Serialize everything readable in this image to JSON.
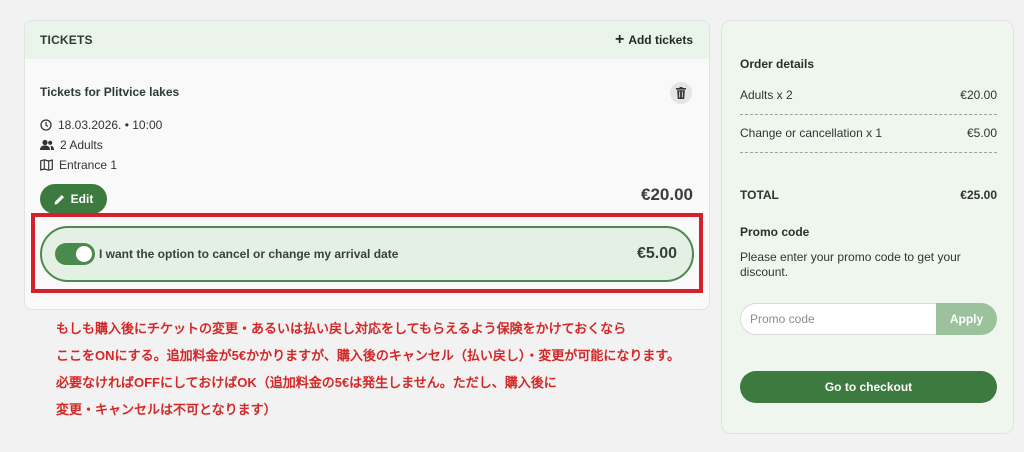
{
  "tickets": {
    "header_title": "TICKETS",
    "add_tickets_label": "Add tickets",
    "ticket_name": "Tickets for Plitvice lakes",
    "date_time": "18.03.2026. • 10:00",
    "guests": "2 Adults",
    "entrance": "Entrance 1",
    "edit_label": "Edit",
    "price": "€20.00",
    "option": {
      "label": "I want the option to cancel or change my arrival date",
      "price": "€5.00",
      "enabled": true
    }
  },
  "annotation": {
    "lines": [
      "もしも購入後にチケットの変更・あるいは払い戻し対応をしてもらえるよう保険をかけておくなら",
      "ここをONにする。追加料金が5€かかりますが、購入後のキャンセル（払い戻し）・変更が可能になります。",
      "必要なければOFFにしておけばOK（追加料金の5€は発生しません。ただし、購入後に",
      "変更・キャンセルは不可となります）"
    ],
    "color": "#d42828"
  },
  "order": {
    "title": "Order details",
    "rows": [
      {
        "label": "Adults x 2",
        "amount": "€20.00"
      },
      {
        "label": "Change or cancellation x 1",
        "amount": "€5.00"
      }
    ],
    "total_label": "TOTAL",
    "total_amount": "€25.00",
    "promo_title": "Promo code",
    "promo_text": "Please enter your promo code to get your discount.",
    "promo_placeholder": "Promo code",
    "apply_label": "Apply",
    "checkout_label": "Go to checkout"
  },
  "colors": {
    "primary_green": "#3c7a3f",
    "light_green": "#e4f0e4",
    "highlight_red": "#d4202a"
  }
}
